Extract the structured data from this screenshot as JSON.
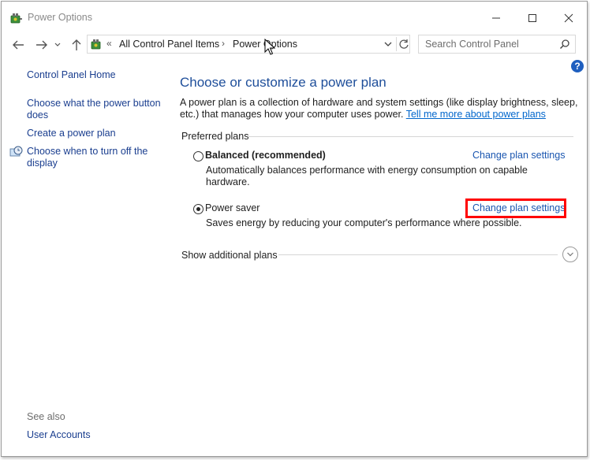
{
  "window": {
    "title": "Power Options"
  },
  "address": {
    "breadcrumbs": [
      "All Control Panel Items",
      "Power Options"
    ],
    "search_placeholder": "Search Control Panel"
  },
  "sidebar": {
    "home": "Control Panel Home",
    "links": [
      "Choose what the power button does",
      "Create a power plan",
      "Choose when to turn off the display"
    ],
    "see_also_label": "See also",
    "see_also_links": [
      "User Accounts"
    ]
  },
  "main": {
    "title": "Choose or customize a power plan",
    "description": "A power plan is a collection of hardware and system settings (like display brightness, sleep, etc.) that manages how your computer uses power.",
    "learn_more_link": "Tell me more about power plans",
    "preferred_label": "Preferred plans",
    "plans": [
      {
        "name": "Balanced (recommended)",
        "description": "Automatically balances performance with energy consumption on capable hardware.",
        "selected": false,
        "link": "Change plan settings"
      },
      {
        "name": "Power saver",
        "description": "Saves energy by reducing your computer's performance where possible.",
        "selected": true,
        "link": "Change plan settings"
      }
    ],
    "show_additional": "Show additional plans"
  },
  "colors": {
    "link": "#1a56b0",
    "title": "#1e4e9a",
    "highlight": "#ff0000"
  }
}
